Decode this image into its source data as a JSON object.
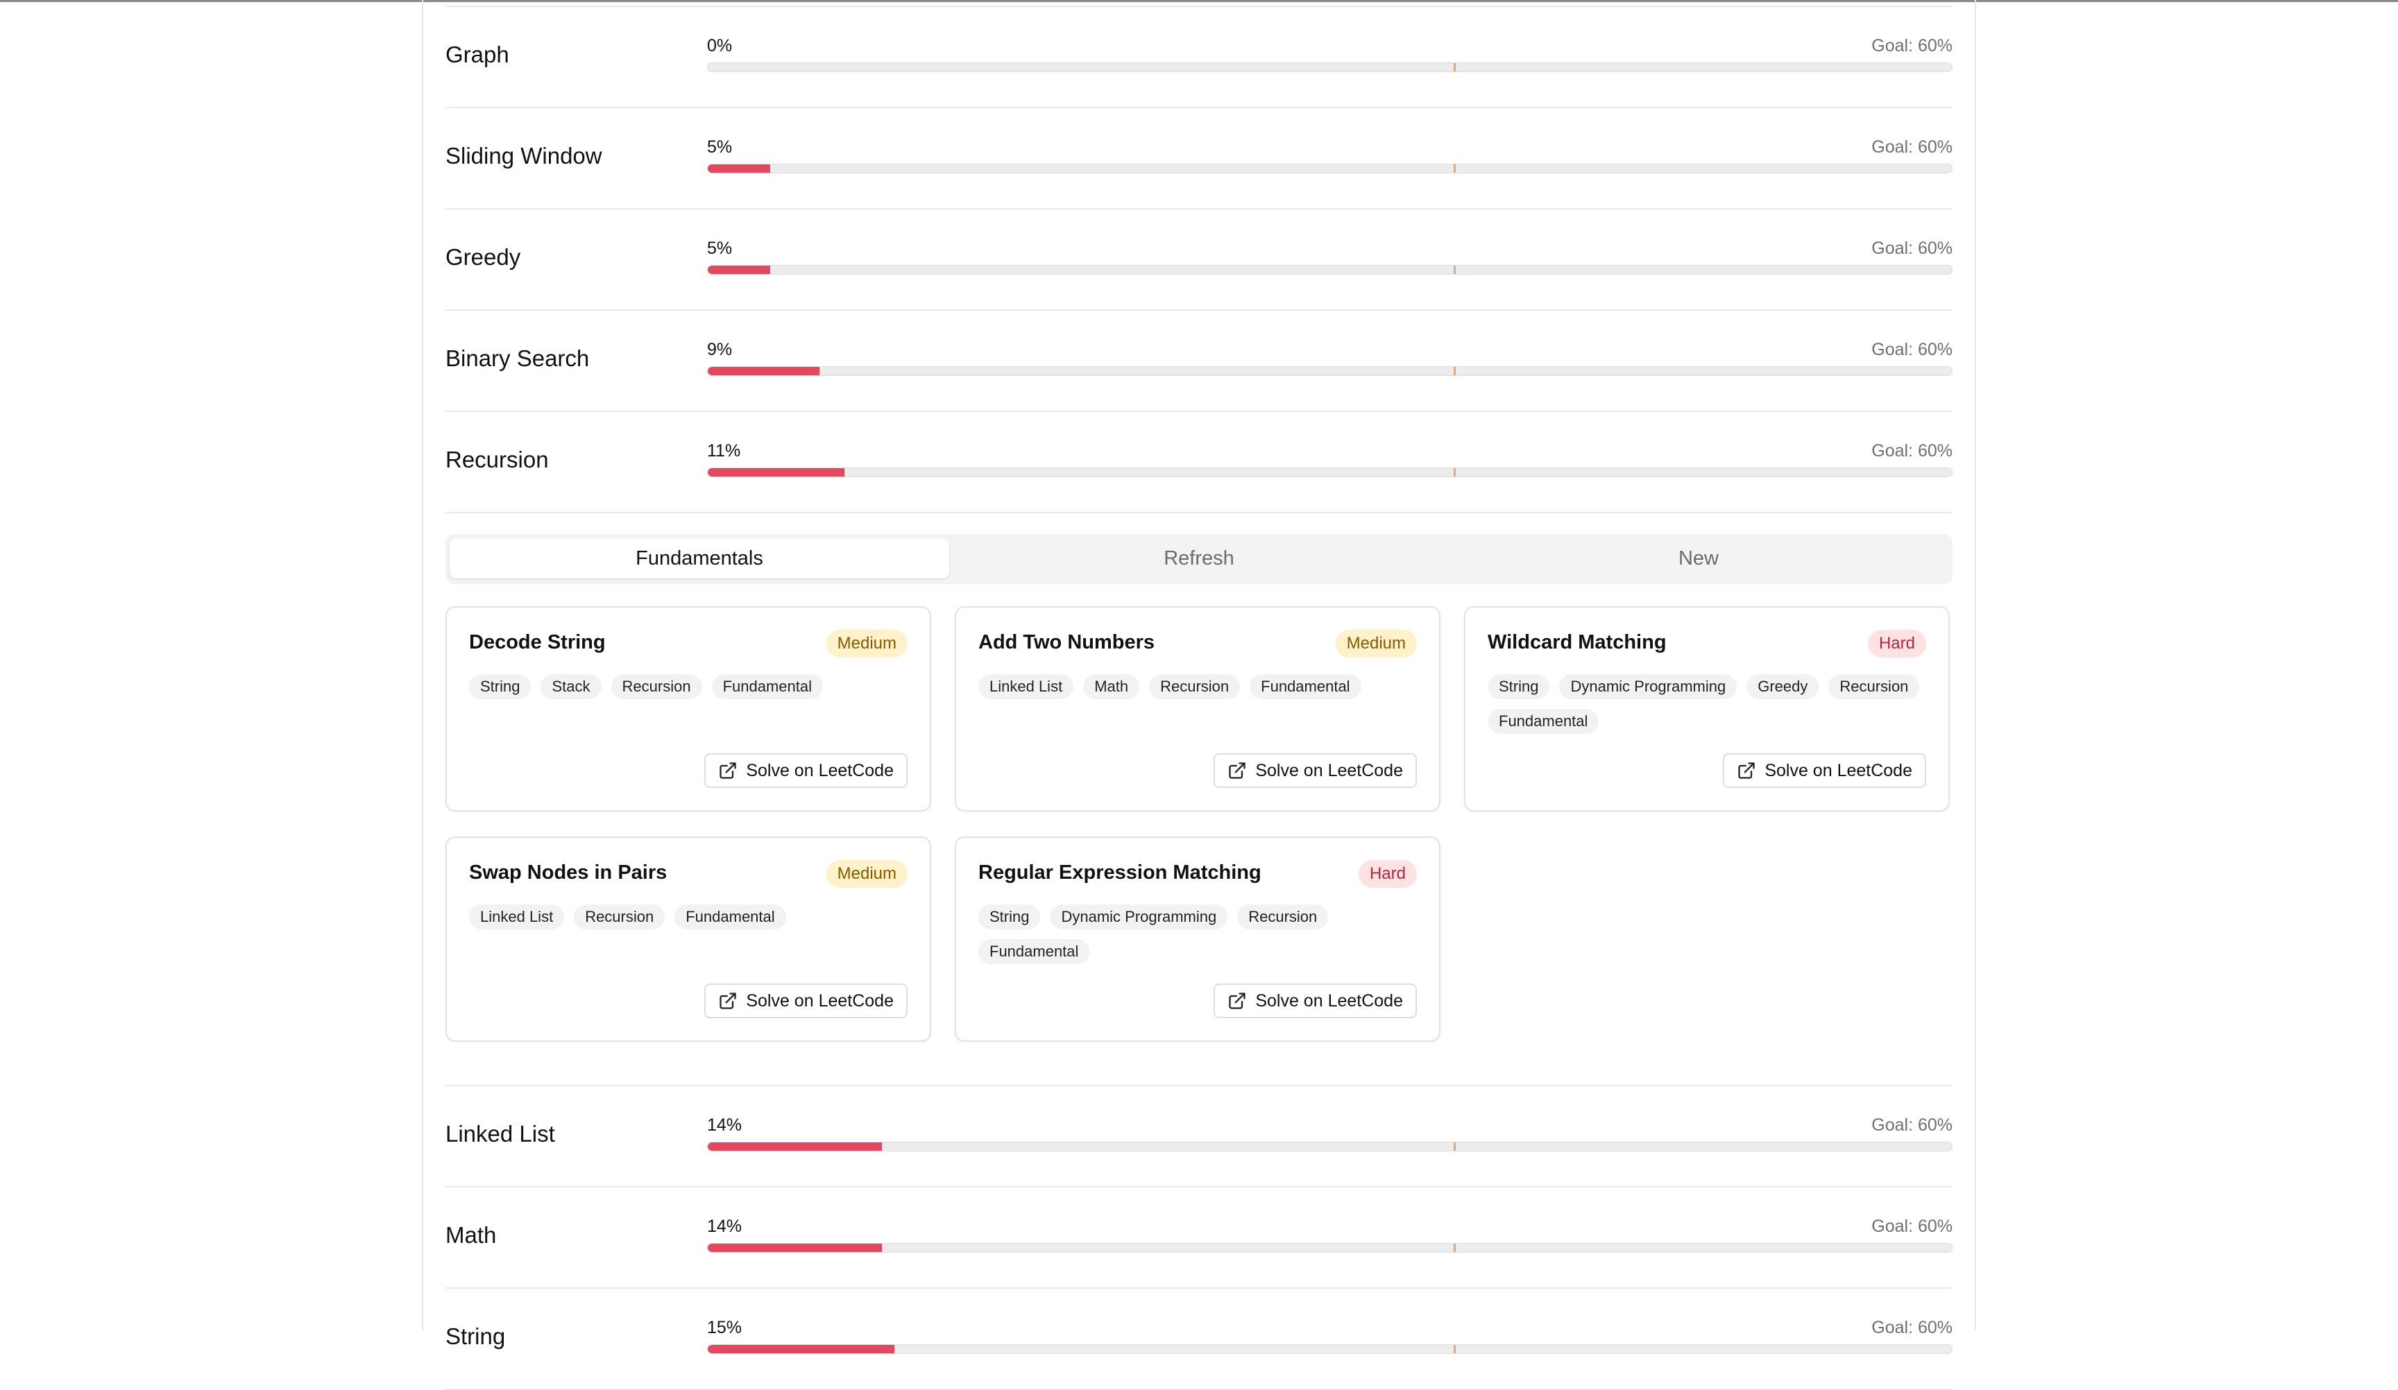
{
  "topics_before": [
    {
      "label": "Graph",
      "percent_text": "0%",
      "percent": 0,
      "goal_text": "Goal: 60%",
      "goal": 60
    },
    {
      "label": "Sliding Window",
      "percent_text": "5%",
      "percent": 5,
      "goal_text": "Goal: 60%",
      "goal": 60
    },
    {
      "label": "Greedy",
      "percent_text": "5%",
      "percent": 5,
      "goal_text": "Goal: 60%",
      "goal": 60
    },
    {
      "label": "Binary Search",
      "percent_text": "9%",
      "percent": 9,
      "goal_text": "Goal: 60%",
      "goal": 60
    },
    {
      "label": "Recursion",
      "percent_text": "11%",
      "percent": 11,
      "goal_text": "Goal: 60%",
      "goal": 60
    }
  ],
  "tabs": [
    {
      "label": "Fundamentals",
      "active": true
    },
    {
      "label": "Refresh",
      "active": false
    },
    {
      "label": "New",
      "active": false
    }
  ],
  "problems": [
    {
      "title": "Decode String",
      "difficulty": "Medium",
      "tags": [
        "String",
        "Stack",
        "Recursion",
        "Fundamental"
      ],
      "button": "Solve on LeetCode"
    },
    {
      "title": "Add Two Numbers",
      "difficulty": "Medium",
      "tags": [
        "Linked List",
        "Math",
        "Recursion",
        "Fundamental"
      ],
      "button": "Solve on LeetCode"
    },
    {
      "title": "Wildcard Matching",
      "difficulty": "Hard",
      "tags": [
        "String",
        "Dynamic Programming",
        "Greedy",
        "Recursion",
        "Fundamental"
      ],
      "button": "Solve on LeetCode"
    },
    {
      "title": "Swap Nodes in Pairs",
      "difficulty": "Medium",
      "tags": [
        "Linked List",
        "Recursion",
        "Fundamental"
      ],
      "button": "Solve on LeetCode"
    },
    {
      "title": "Regular Expression Matching",
      "difficulty": "Hard",
      "tags": [
        "String",
        "Dynamic Programming",
        "Recursion",
        "Fundamental"
      ],
      "button": "Solve on LeetCode"
    }
  ],
  "topics_after": [
    {
      "label": "Linked List",
      "percent_text": "14%",
      "percent": 14,
      "goal_text": "Goal: 60%",
      "goal": 60
    },
    {
      "label": "Math",
      "percent_text": "14%",
      "percent": 14,
      "goal_text": "Goal: 60%",
      "goal": 60
    },
    {
      "label": "String",
      "percent_text": "15%",
      "percent": 15,
      "goal_text": "Goal: 60%",
      "goal": 60
    }
  ],
  "colors": {
    "progress_fill": "#e5485e",
    "goal_marker": "#f0a56b",
    "medium_badge": "#fdf2c9",
    "hard_badge": "#fde2e4"
  },
  "icons": {
    "solve_button": "external-link-icon"
  }
}
